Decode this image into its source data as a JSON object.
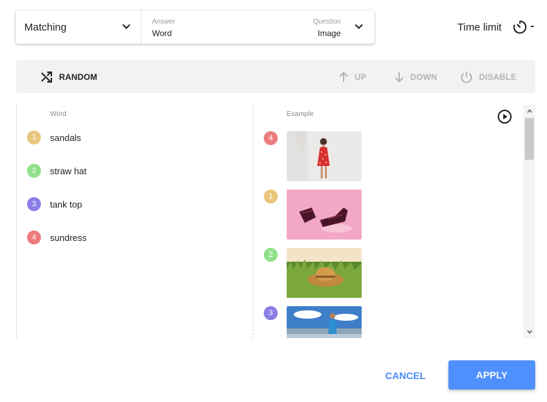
{
  "header": {
    "mode": "Matching",
    "answer_caption": "Answer",
    "answer_value": "Word",
    "question_caption": "Question",
    "question_value": "Image",
    "time_limit_label": "Time limit",
    "time_limit_value": "-"
  },
  "toolbar": {
    "random_label": "RANDOM",
    "up_label": "UP",
    "down_label": "DOWN",
    "disable_label": "DISABLE"
  },
  "columns": {
    "word_header": "Word",
    "example_header": "Example"
  },
  "words": [
    {
      "number": "1",
      "text": "sandals",
      "color": "#e8c77d"
    },
    {
      "number": "2",
      "text": "straw hat",
      "color": "#8fe08a"
    },
    {
      "number": "3",
      "text": "tank top",
      "color": "#8b7ee6"
    },
    {
      "number": "4",
      "text": "sundress",
      "color": "#ec7b7b"
    }
  ],
  "examples": [
    {
      "number": "4",
      "image": "woman in red sundress",
      "color": "#ec7b7b"
    },
    {
      "number": "1",
      "image": "sandals on pink background",
      "color": "#e8c77d"
    },
    {
      "number": "2",
      "image": "straw hat in grass",
      "color": "#8fe08a"
    },
    {
      "number": "3",
      "image": "man in tank top by lake",
      "color": "#8b7ee6"
    }
  ],
  "footer": {
    "cancel_label": "CANCEL",
    "apply_label": "APPLY"
  },
  "colors": {
    "accent": "#4d90fe",
    "toolbar_bg": "#f2f2f2",
    "disabled_text": "#b5b5b5"
  }
}
